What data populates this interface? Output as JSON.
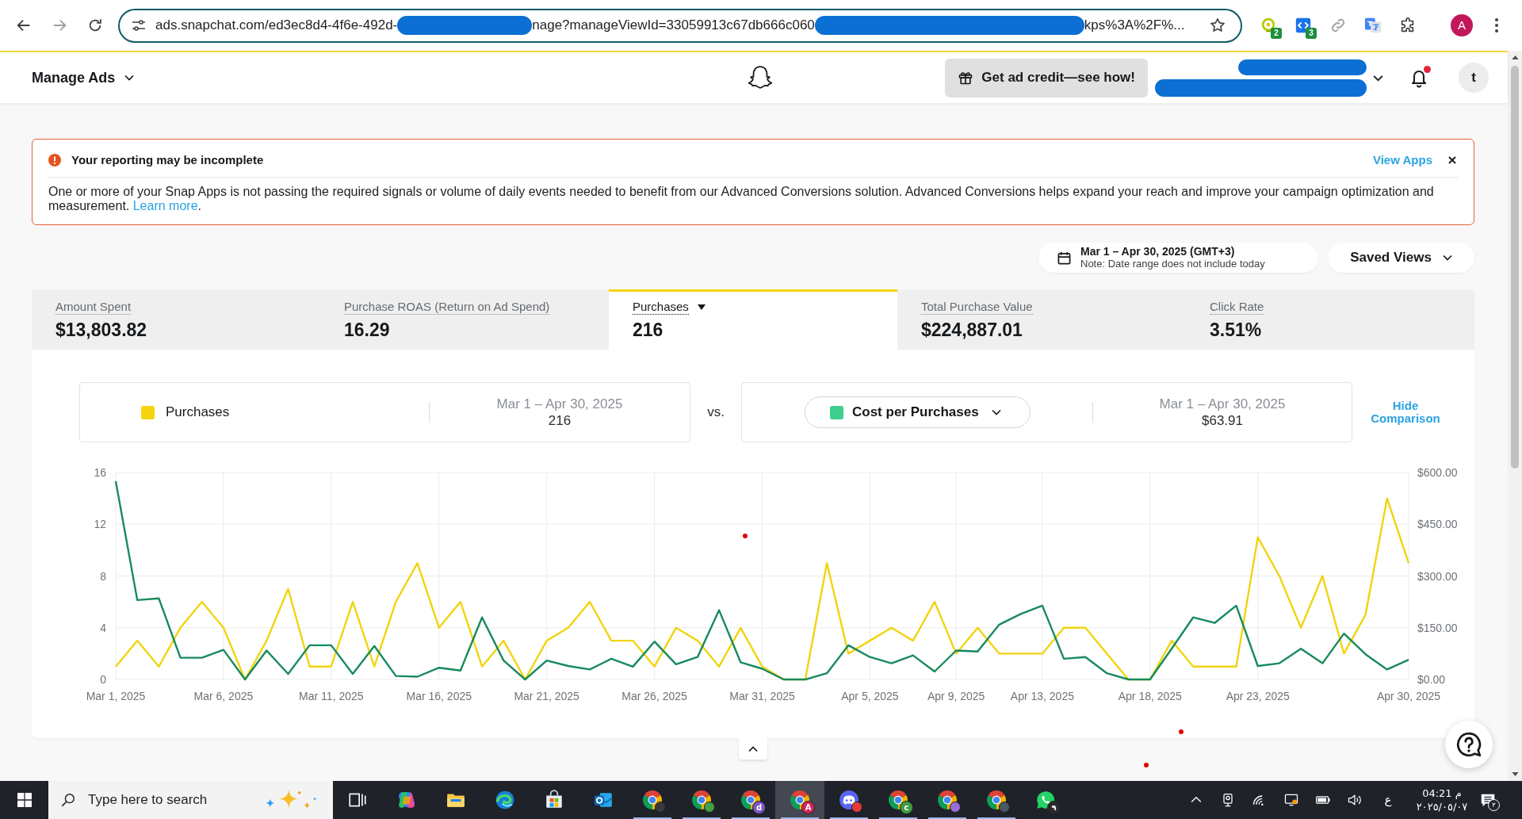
{
  "browser": {
    "url_segments": [
      {
        "kind": "text",
        "text": "ads.snapchat.com/ed3ec8d4-4f6e-492d-"
      },
      {
        "kind": "redacted"
      },
      {
        "kind": "text",
        "text": "nage?manageViewId=33059913c67db666c060"
      },
      {
        "kind": "redacted"
      },
      {
        "kind": "text",
        "text": "kps%3A%2F%..."
      }
    ],
    "extensions": [
      {
        "kind": "bulb",
        "badge": "2"
      },
      {
        "kind": "code",
        "badge": "3"
      },
      {
        "kind": "link"
      },
      {
        "kind": "translate"
      },
      {
        "kind": "puzzle"
      }
    ],
    "profile_initial": "A"
  },
  "header": {
    "title": "Manage Ads",
    "promo_button": "Get ad credit—see how!",
    "account_redacted": true,
    "has_notifications": true,
    "avatar_initial": "t"
  },
  "alert": {
    "title": "Your reporting may be incomplete",
    "action": "View Apps",
    "message": "One or more of your Snap Apps is not passing the required signals or volume of daily events needed to benefit from our Advanced Conversions solution. Advanced Conversions helps expand your reach and improve your campaign optimization and measurement.",
    "link": "Learn more",
    "message_end": "."
  },
  "toolbar": {
    "date_range": "Mar 1 – Apr 30, 2025 (GMT+3)",
    "date_note": "Note: Date range does not include today",
    "saved_views": "Saved Views"
  },
  "metrics": [
    {
      "label": "Amount Spent",
      "value": "$13,803.82",
      "selected": false
    },
    {
      "label": "Purchase ROAS (Return on Ad Spend)",
      "value": "16.29",
      "selected": false
    },
    {
      "label": "Purchases",
      "value": "216",
      "selected": true
    },
    {
      "label": "Total Purchase Value",
      "value": "$224,887.01",
      "selected": false
    },
    {
      "label": "Click Rate",
      "value": "3.51%",
      "selected": false
    }
  ],
  "comparison": {
    "primary": {
      "name": "Purchases",
      "color": "#f5d410",
      "range": "Mar 1 – Apr 30, 2025",
      "total": "216"
    },
    "vs": "vs.",
    "secondary": {
      "name": "Cost per Purchases",
      "color": "#3ccf8e",
      "range": "Mar 1 – Apr 30, 2025",
      "total": "$63.91"
    },
    "hide_button": "Hide Comparison"
  },
  "chart": {
    "chart_data": {
      "type": "line",
      "grid": true,
      "categories": [
        "Mar 1, 2025",
        null,
        null,
        null,
        null,
        "Mar 6, 2025",
        null,
        null,
        null,
        null,
        "Mar 11, 2025",
        null,
        null,
        null,
        null,
        "Mar 16, 2025",
        null,
        null,
        null,
        null,
        "Mar 21, 2025",
        null,
        null,
        null,
        null,
        "Mar 26, 2025",
        null,
        null,
        null,
        null,
        "Mar 31, 2025",
        null,
        null,
        null,
        null,
        "Apr 5, 2025",
        null,
        null,
        null,
        "Apr 9, 2025",
        null,
        null,
        null,
        "Apr 13, 2025",
        null,
        null,
        null,
        null,
        "Apr 18, 2025",
        null,
        null,
        null,
        null,
        "Apr 23, 2025",
        null,
        null,
        null,
        null,
        null,
        null,
        "Apr 30, 2025"
      ],
      "ylim": [
        0,
        16
      ],
      "yticks": [
        0,
        4,
        8,
        12,
        16
      ],
      "y2lim": [
        0,
        600
      ],
      "y2ticks": [
        {
          "value": 0,
          "label": "$0.00"
        },
        {
          "value": 150,
          "label": "$150.00"
        },
        {
          "value": 300,
          "label": "$300.00"
        },
        {
          "value": 450,
          "label": "$450.00"
        },
        {
          "value": 600,
          "label": "$600.00"
        }
      ],
      "series": [
        {
          "color": "#f2d40f",
          "values": [
            1,
            3,
            1,
            4,
            6,
            4,
            0,
            3,
            7,
            1,
            1,
            6,
            1,
            6,
            9,
            4,
            6,
            1,
            3,
            0,
            3,
            4,
            6,
            3,
            3,
            1,
            4,
            3,
            1,
            4,
            1,
            0,
            0,
            9,
            2,
            3,
            4,
            3,
            6,
            2,
            4,
            2,
            2,
            2,
            4,
            4,
            2,
            0,
            0,
            3,
            1,
            1,
            1,
            11,
            8,
            4,
            8,
            2,
            5,
            14,
            9
          ]
        },
        {
          "color": "#178a5c",
          "axis": "y2",
          "values": [
            575,
            230,
            235,
            63,
            63,
            86,
            0,
            84,
            16,
            99,
            99,
            16,
            97,
            10,
            8,
            34,
            26,
            180,
            55,
            0,
            55,
            39,
            29,
            60,
            37,
            110,
            44,
            65,
            201,
            50,
            31,
            0,
            0,
            18,
            99,
            65,
            47,
            70,
            23,
            84,
            81,
            159,
            190,
            214,
            60,
            65,
            18,
            0,
            0,
            89,
            180,
            164,
            214,
            39,
            47,
            89,
            47,
            133,
            73,
            29,
            57
          ]
        }
      ]
    }
  },
  "taskbar": {
    "search_placeholder": "Type here to search",
    "apps": [
      {
        "kind": "task-view",
        "selected": false,
        "running": false
      },
      {
        "kind": "copilot",
        "selected": false,
        "running": false
      },
      {
        "kind": "folder",
        "selected": false,
        "running": false
      },
      {
        "kind": "edge",
        "selected": false,
        "running": false
      },
      {
        "kind": "store",
        "selected": false,
        "running": false
      },
      {
        "kind": "mail",
        "selected": false,
        "running": false
      },
      {
        "kind": "browser",
        "color": "#3a3a3a",
        "selected": false,
        "running": true
      },
      {
        "kind": "browser",
        "color": "#43a047",
        "selected": false,
        "running": true
      },
      {
        "kind": "browser",
        "color": "#7b55c7",
        "badge": "d",
        "selected": false,
        "running": true
      },
      {
        "kind": "browser",
        "color": "#d3245a",
        "badge": "A",
        "selected": true,
        "running": true
      },
      {
        "kind": "discord",
        "color": "#e53935",
        "selected": false,
        "running": true
      },
      {
        "kind": "browser",
        "color": "#3f9d45",
        "badge": "c",
        "selected": false,
        "running": true
      },
      {
        "kind": "browser",
        "color": "#9b6fd8",
        "selected": false,
        "running": true
      },
      {
        "kind": "browser",
        "color": "#4b5963",
        "selected": false,
        "running": true
      },
      {
        "kind": "whatsapp",
        "color": "#2a2a2a",
        "badge": "٩",
        "selected": false,
        "running": false
      }
    ],
    "tray": {
      "language": "ع",
      "time": "04:21 م",
      "date": "٢٠٢٥/٠٥/٠٧",
      "notification_count": "٢"
    }
  }
}
